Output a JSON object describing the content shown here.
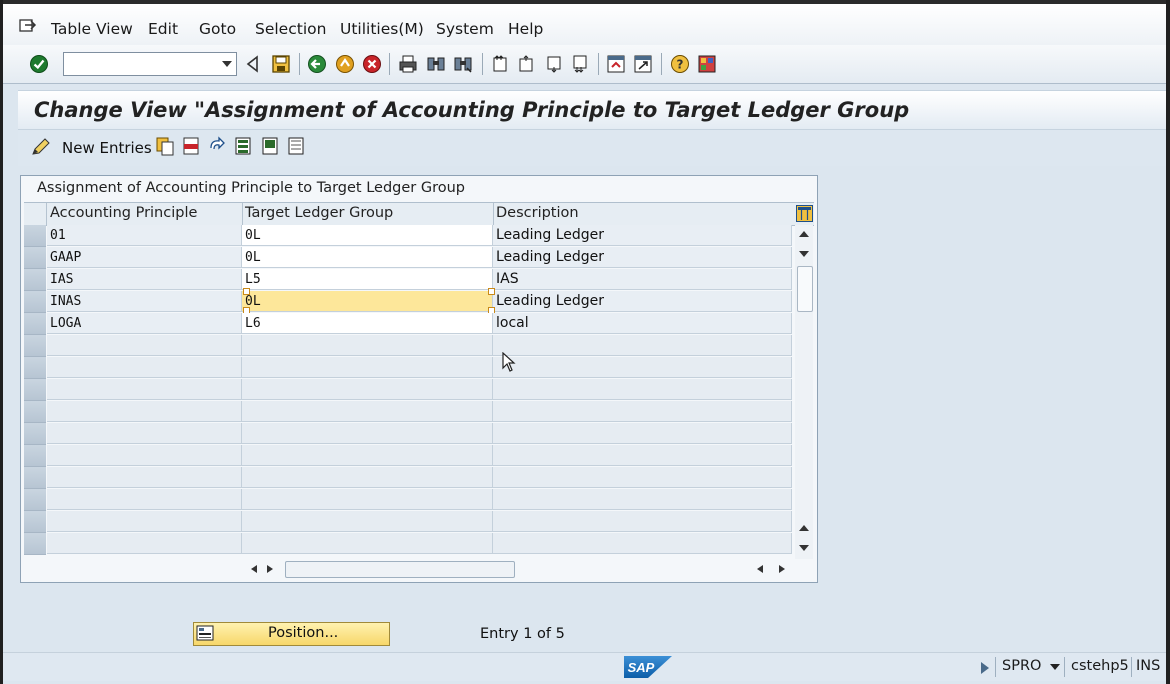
{
  "menubar": {
    "items": [
      {
        "label": "Table View"
      },
      {
        "label": "Edit"
      },
      {
        "label": "Goto"
      },
      {
        "label": "Selection"
      },
      {
        "label": "Utilities(M)"
      },
      {
        "label": "System"
      },
      {
        "label": "Help"
      }
    ]
  },
  "toolbar": {
    "command_value": "",
    "icons": [
      "enter-icon",
      "back-icon",
      "save-icon",
      "back-green-icon",
      "exit-icon",
      "cancel-icon",
      "print-icon",
      "find-icon",
      "find-next-icon",
      "first-page-icon",
      "previous-page-icon",
      "next-page-icon",
      "last-page-icon",
      "create-session-icon",
      "shortcut-icon",
      "help-icon",
      "customize-layout-icon"
    ]
  },
  "title": "Change View \"Assignment of Accounting Principle to Target Ledger Group",
  "app_toolbar": {
    "new_entries": "New Entries",
    "icons": [
      "copy-as-icon",
      "delete-icon",
      "undo-change-icon",
      "select-all-icon",
      "select-block-icon",
      "deselect-all-icon"
    ]
  },
  "table": {
    "title": "Assignment of Accounting Principle to Target Ledger Group",
    "columns": [
      "Accounting Principle",
      "Target Ledger Group",
      "Description"
    ],
    "rows": [
      {
        "principle": "01",
        "ledger_group": "0L",
        "description": "Leading Ledger"
      },
      {
        "principle": "GAAP",
        "ledger_group": "0L",
        "description": "Leading Ledger"
      },
      {
        "principle": "IAS",
        "ledger_group": "L5",
        "description": "IAS"
      },
      {
        "principle": "INAS",
        "ledger_group": "0L",
        "description": "Leading Ledger"
      },
      {
        "principle": "LOGA",
        "ledger_group": "L6",
        "description": "local"
      }
    ]
  },
  "position_button": "Position...",
  "entry_info": "Entry 1 of 5",
  "status": {
    "transaction": "SPRO",
    "server": "cstehp5",
    "mode": "INS",
    "logo": "SAP"
  },
  "colors": {
    "background": "#dfe8f1",
    "highlight": "#fde79a",
    "accent": "#1d6fb5"
  }
}
